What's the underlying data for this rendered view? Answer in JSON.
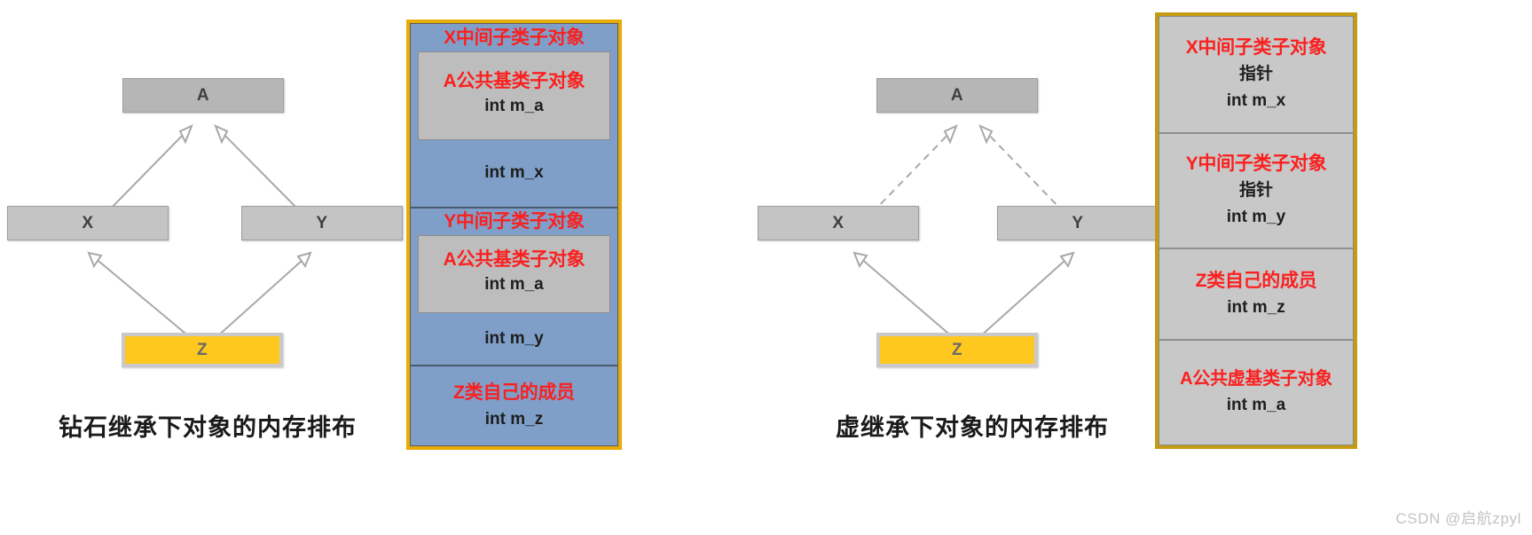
{
  "watermark": "CSDN @启航zpyl",
  "left": {
    "caption": "钻石继承下对象的内存排布",
    "classes": {
      "a": "A",
      "x": "X",
      "y": "Y",
      "z": "Z"
    },
    "inheritance": "solid",
    "memory": {
      "border_color": "#e8ac07",
      "fill_color": "#7f9fc8",
      "blocks": [
        {
          "title": "X中间子类子对象",
          "sub": {
            "title": "A公共基类子对象",
            "members": [
              "int m_a"
            ]
          },
          "members": [
            "int m_x"
          ]
        },
        {
          "title": "Y中间子类子对象",
          "sub": {
            "title": "A公共基类子对象",
            "members": [
              "int m_a"
            ]
          },
          "members": [
            "int m_y"
          ]
        },
        {
          "title": "Z类自己的成员",
          "members": [
            "int m_z"
          ]
        }
      ]
    }
  },
  "right": {
    "caption": "虚继承下对象的内存排布",
    "classes": {
      "a": "A",
      "x": "X",
      "y": "Y",
      "z": "Z"
    },
    "inheritance": "dashed",
    "memory": {
      "border_color": "#c49b12",
      "fill_color": "#c8c8c8",
      "blocks": [
        {
          "title": "X中间子类子对象",
          "members": [
            "指针",
            "int m_x"
          ]
        },
        {
          "title": "Y中间子类子对象",
          "members": [
            "指针",
            "int m_y"
          ]
        },
        {
          "title": "Z类自己的成员",
          "members": [
            "int m_z"
          ]
        },
        {
          "title": "A公共虚基类子对象",
          "members": [
            "int m_a"
          ]
        }
      ]
    }
  }
}
